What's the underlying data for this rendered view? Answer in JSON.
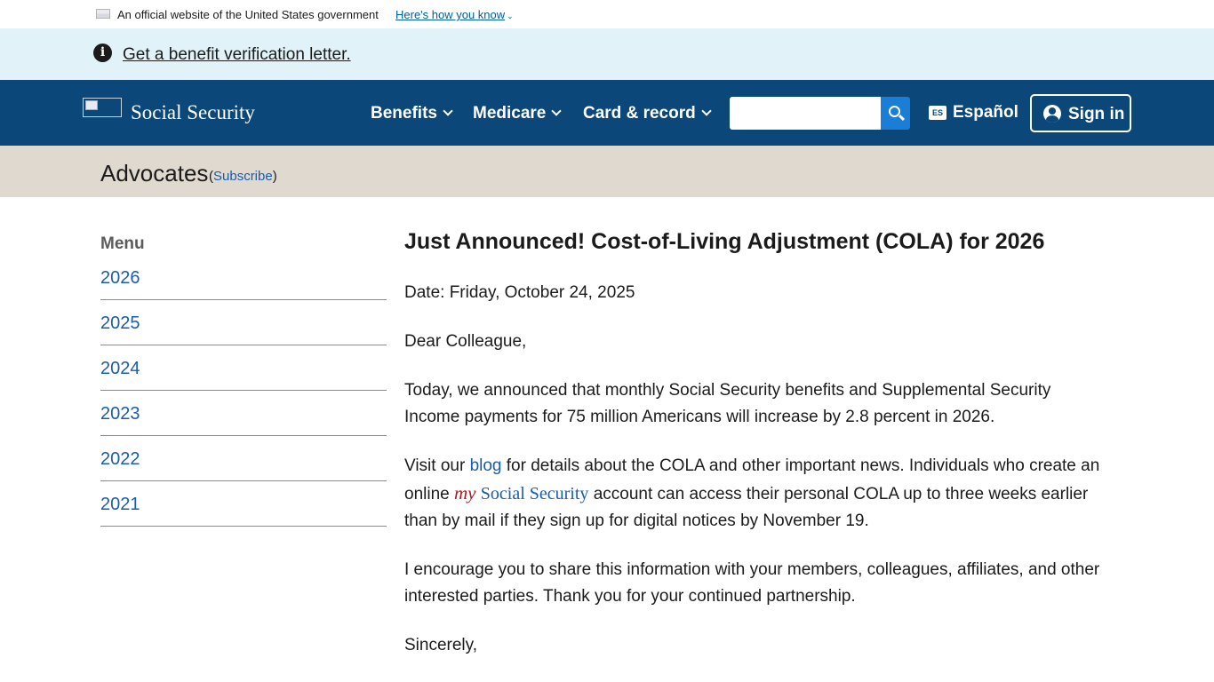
{
  "gov_banner": {
    "text": "An official website of the United States government",
    "how_link": "Here's how you know"
  },
  "alert": {
    "link_text": "Get a benefit verification letter."
  },
  "header": {
    "logo_text": "Social Security",
    "nav": {
      "benefits": "Benefits",
      "medicare": "Medicare",
      "card_record": "Card & record"
    },
    "search": {
      "value": "",
      "placeholder": ""
    },
    "espanol": "Español",
    "es_badge": "ES",
    "signin": "Sign in"
  },
  "subheader": {
    "title": "Advocates",
    "open_paren": "(",
    "subscribe": "Subscribe",
    "close_paren": ")"
  },
  "sidebar": {
    "heading": "Menu",
    "items": [
      "2026",
      "2025",
      "2024",
      "2023",
      "2022",
      "2021"
    ]
  },
  "article": {
    "title": "Just Announced! Cost-of-Living Adjustment (COLA) for 2026",
    "date": "Date: Friday, October 24, 2025",
    "greeting": "Dear Colleague,",
    "para1": "Today, we announced that monthly Social Security benefits and Supplemental Security Income payments for 75 million Americans will increase by 2.8 percent in 2026.",
    "para2_prefix": "Visit our ",
    "para2_blog": "blog",
    "para2_mid": " for details about the COLA and other important news. Individuals who create an online ",
    "para2_my": "my",
    "para2_ss": "Social Security",
    "para2_suffix": " account can access their personal COLA up to three weeks earlier than by mail if they sign up for digital notices by November 19.",
    "para3": "I encourage you to share this information with your members, colleagues, affiliates, and other interested parties. Thank you for your continued partnership.",
    "closing": "Sincerely,"
  },
  "colors": {
    "header_bg": "#0b4778",
    "alert_bg": "#e1f3f8",
    "subheader_bg": "#e0d9cf",
    "link": "#1a5cae",
    "search_button": "#1a7dd6",
    "my_red": "#b3191d"
  }
}
